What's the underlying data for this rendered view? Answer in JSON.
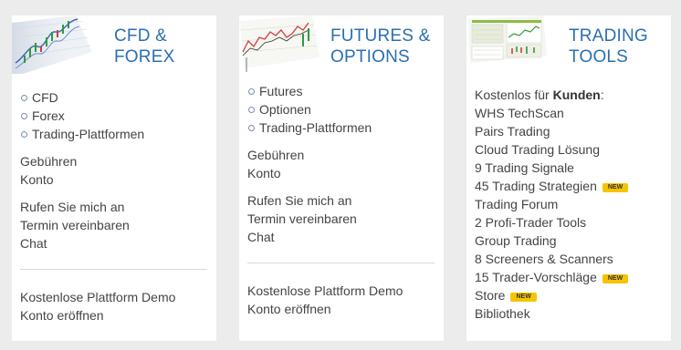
{
  "colors": {
    "title": "#2a6fb3",
    "badge": "#f5c400",
    "card": "#ffffff",
    "page": "#ececec"
  },
  "cards": [
    {
      "title_line1": "CFD &",
      "title_line2": "FOREX",
      "image": "candlestick-chart-thumbnail",
      "bullets": [
        "CFD",
        "Forex",
        "Trading-Plattformen"
      ],
      "group1": [
        "Gebühren",
        "Konto"
      ],
      "group2": [
        "Rufen Sie mich an",
        "Termin vereinbaren",
        "Chat"
      ],
      "group3": [
        "Kostenlose Plattform Demo",
        "Konto eröffnen"
      ]
    },
    {
      "title_line1": "FUTURES &",
      "title_line2": "OPTIONS",
      "image": "price-chart-thumbnail",
      "bullets": [
        "Futures",
        "Optionen",
        "Trading-Plattformen"
      ],
      "group1": [
        "Gebühren",
        "Konto"
      ],
      "group2": [
        "Rufen Sie mich an",
        "Termin vereinbaren",
        "Chat"
      ],
      "group3": [
        "Kostenlose Plattform Demo",
        "Konto eröffnen"
      ]
    },
    {
      "title_line1": "TRADING",
      "title_line2": "TOOLS",
      "image": "trading-tools-thumbnail",
      "intro_prefix": "Kostenlos für ",
      "intro_bold": "Kunden",
      "intro_suffix": ":",
      "badge_label": "NEW",
      "tools": [
        {
          "label": "WHS TechScan",
          "new": false
        },
        {
          "label": "Pairs Trading",
          "new": false
        },
        {
          "label": "Cloud Trading Lösung",
          "new": false
        },
        {
          "label": "9 Trading Signale",
          "new": false
        },
        {
          "label": "45 Trading Strategien",
          "new": true
        },
        {
          "label": "Trading Forum",
          "new": false
        },
        {
          "label": "2 Profi-Trader Tools",
          "new": false
        },
        {
          "label": "Group Trading",
          "new": false
        },
        {
          "label": "8 Screeners & Scanners",
          "new": false
        },
        {
          "label": "15 Trader-Vorschläge",
          "new": true
        },
        {
          "label": "Store",
          "new": true
        },
        {
          "label": "Bibliothek",
          "new": false
        }
      ]
    }
  ]
}
